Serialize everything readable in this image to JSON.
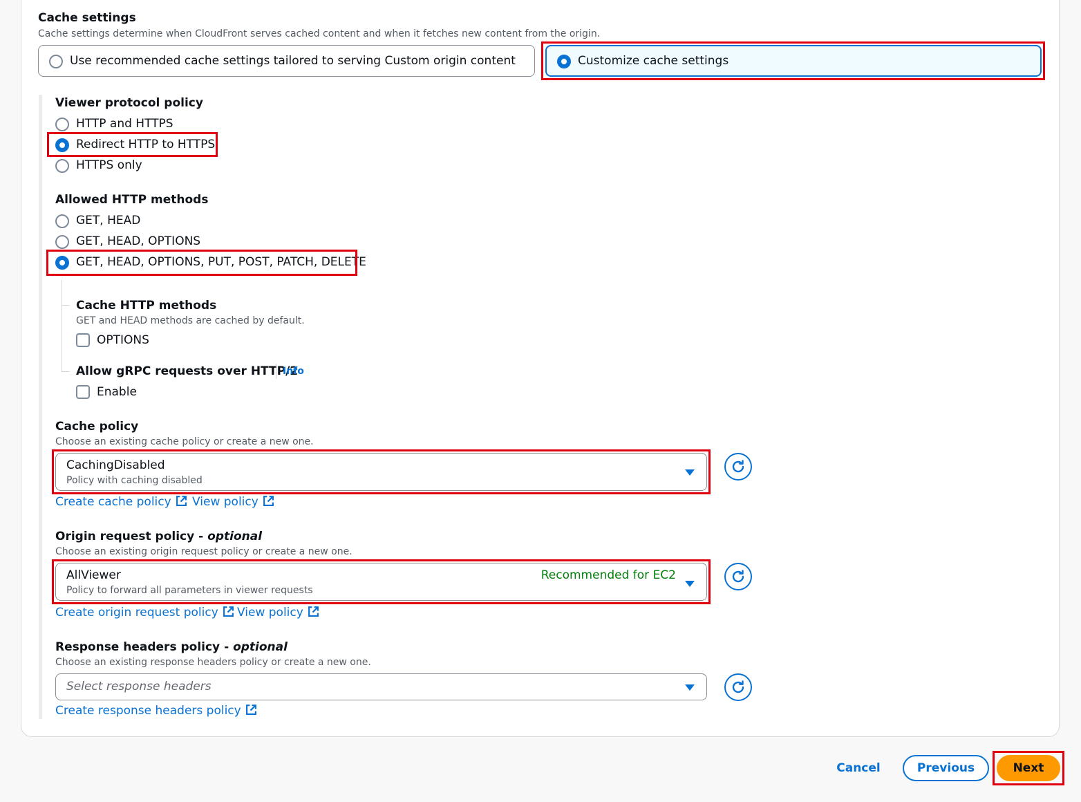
{
  "cache_settings": {
    "title": "Cache settings",
    "description": "Cache settings determine when CloudFront serves cached content and when it fetches new content from the origin.",
    "options": [
      {
        "label": "Use recommended cache settings tailored to serving Custom origin content",
        "selected": false
      },
      {
        "label": "Customize cache settings",
        "selected": true
      }
    ]
  },
  "viewer_protocol": {
    "title": "Viewer protocol policy",
    "options": [
      {
        "label": "HTTP and HTTPS",
        "selected": false
      },
      {
        "label": "Redirect HTTP to HTTPS",
        "selected": true
      },
      {
        "label": "HTTPS only",
        "selected": false
      }
    ]
  },
  "allowed_methods": {
    "title": "Allowed HTTP methods",
    "options": [
      {
        "label": "GET, HEAD",
        "selected": false
      },
      {
        "label": "GET, HEAD, OPTIONS",
        "selected": false
      },
      {
        "label": "GET, HEAD, OPTIONS, PUT, POST, PATCH, DELETE",
        "selected": true
      }
    ]
  },
  "cache_methods": {
    "title": "Cache HTTP methods",
    "description": "GET and HEAD methods are cached by default.",
    "checkbox_label": "OPTIONS",
    "checked": false
  },
  "grpc": {
    "title": "Allow gRPC requests over HTTP/2",
    "info": "Info",
    "checkbox_label": "Enable",
    "checked": false
  },
  "cache_policy": {
    "title": "Cache policy",
    "description": "Choose an existing cache policy or create a new one.",
    "value": "CachingDisabled",
    "value_description": "Policy with caching disabled",
    "create_link": "Create cache policy",
    "view_link": "View policy"
  },
  "origin_request_policy": {
    "title": "Origin request policy",
    "optional": "optional",
    "description": "Choose an existing origin request policy or create a new one.",
    "value": "AllViewer",
    "value_description": "Policy to forward all parameters in viewer requests",
    "tag": "Recommended for EC2",
    "create_link": "Create origin request policy",
    "view_link": "View policy"
  },
  "response_headers_policy": {
    "title": "Response headers policy",
    "optional": "optional",
    "description": "Choose an existing response headers policy or create a new one.",
    "placeholder": "Select response headers",
    "create_link": "Create response headers policy"
  },
  "footer": {
    "cancel": "Cancel",
    "previous": "Previous",
    "next": "Next"
  },
  "colors": {
    "accent": "#0972d3",
    "highlight": "#e0000f",
    "primary_button": "#ff9900",
    "recommended_tag": "#037f0c"
  }
}
